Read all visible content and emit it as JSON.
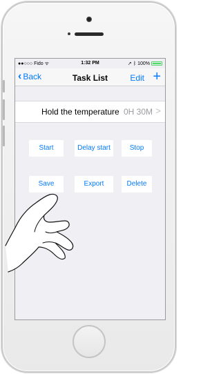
{
  "status_bar": {
    "carrier": "●●○○○ Fido",
    "time": "1:32 PM",
    "battery": "100%"
  },
  "nav": {
    "back_label": "Back",
    "title": "Task List",
    "edit_label": "Edit",
    "add_symbol": "+"
  },
  "task": {
    "name": "Hold the temperature",
    "duration": "0H 30M",
    "chevron": ">"
  },
  "actions": {
    "start": "Start",
    "delay_start": "Delay start",
    "stop": "Stop",
    "save": "Save",
    "export": "Export",
    "delete": "Delete"
  },
  "colors": {
    "accent": "#007aff",
    "screen_bg": "#efeff4",
    "battery": "#4cd964"
  }
}
